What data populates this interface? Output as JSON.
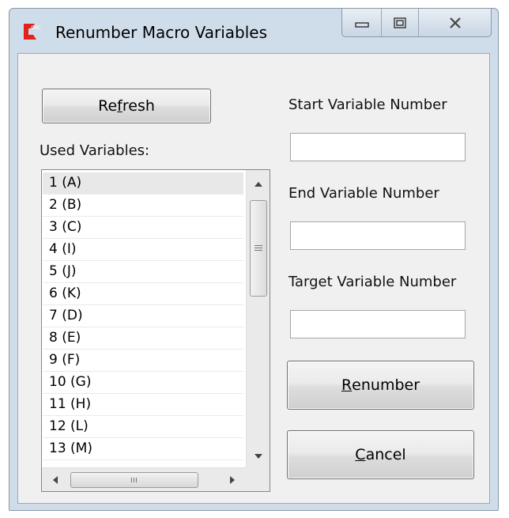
{
  "window": {
    "title": "Renumber Macro Variables",
    "icon": "red-cnc-logo-icon",
    "icon_text": "CNC",
    "controls": [
      "minimize-icon",
      "maximize-icon",
      "close-icon"
    ]
  },
  "colors": {
    "titlebar": "#cfdcea",
    "client_bg": "#f0f0f0",
    "accent_red": "#e0241b"
  },
  "refresh": {
    "before": "Re",
    "mnemonic": "f",
    "after": "resh"
  },
  "used_variables": {
    "label": "Used Variables:",
    "items": [
      "1 (A)",
      "2 (B)",
      "3 (C)",
      "4 (I)",
      "5 (J)",
      "6 (K)",
      "7 (D)",
      "8 (E)",
      "9 (F)",
      "10 (G)",
      "11 (H)",
      "12 (L)",
      "13 (M)"
    ]
  },
  "start": {
    "label": "Start Variable Number",
    "value": ""
  },
  "end": {
    "label": "End Variable Number",
    "value": ""
  },
  "target": {
    "label": "Target Variable Number",
    "value": ""
  },
  "renumber": {
    "mnemonic": "R",
    "after": "enumber"
  },
  "cancel": {
    "mnemonic": "C",
    "after": "ancel"
  }
}
